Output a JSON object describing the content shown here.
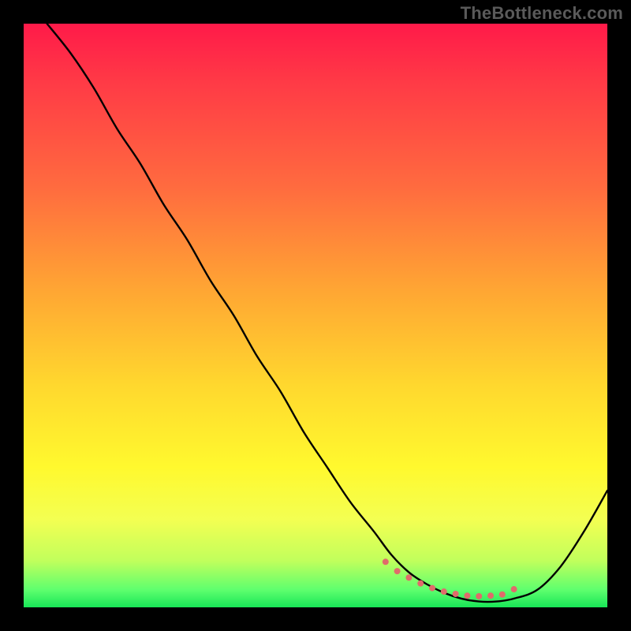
{
  "watermark": "TheBottleneck.com",
  "chart_data": {
    "type": "line",
    "title": "",
    "xlabel": "",
    "ylabel": "",
    "xlim": [
      0,
      100
    ],
    "ylim": [
      0,
      100
    ],
    "grid": false,
    "legend": false,
    "background_gradient": {
      "direction": "vertical",
      "stops": [
        {
          "pos": 0.0,
          "color": "#ff1a49"
        },
        {
          "pos": 0.1,
          "color": "#ff3a46"
        },
        {
          "pos": 0.28,
          "color": "#ff6b3f"
        },
        {
          "pos": 0.46,
          "color": "#ffa733"
        },
        {
          "pos": 0.62,
          "color": "#ffd82e"
        },
        {
          "pos": 0.76,
          "color": "#fff92e"
        },
        {
          "pos": 0.85,
          "color": "#f3ff52"
        },
        {
          "pos": 0.92,
          "color": "#c1ff5c"
        },
        {
          "pos": 0.97,
          "color": "#5eff6e"
        },
        {
          "pos": 1.0,
          "color": "#18e657"
        }
      ]
    },
    "series": [
      {
        "name": "bottleneck-curve",
        "color": "#000000",
        "stroke_width": 2,
        "x": [
          4,
          8,
          12,
          16,
          20,
          24,
          28,
          32,
          36,
          40,
          44,
          48,
          52,
          56,
          60,
          63,
          66,
          69,
          72,
          75,
          78,
          81,
          84,
          88,
          92,
          96,
          100
        ],
        "y": [
          100,
          95,
          89,
          82,
          76,
          69,
          63,
          56,
          50,
          43,
          37,
          30,
          24,
          18,
          13,
          9,
          6,
          4,
          2.5,
          1.5,
          1,
          1,
          1.5,
          3,
          7,
          13,
          20
        ]
      }
    ],
    "markers": {
      "name": "highlight-dots",
      "color": "#e06b6b",
      "radius": 4,
      "x": [
        62,
        64,
        66,
        68,
        70,
        72,
        74,
        76,
        78,
        80,
        82,
        84
      ],
      "y": [
        7.8,
        6.2,
        5.1,
        4.1,
        3.3,
        2.7,
        2.3,
        2.0,
        1.9,
        2.0,
        2.2,
        3.1
      ]
    }
  }
}
